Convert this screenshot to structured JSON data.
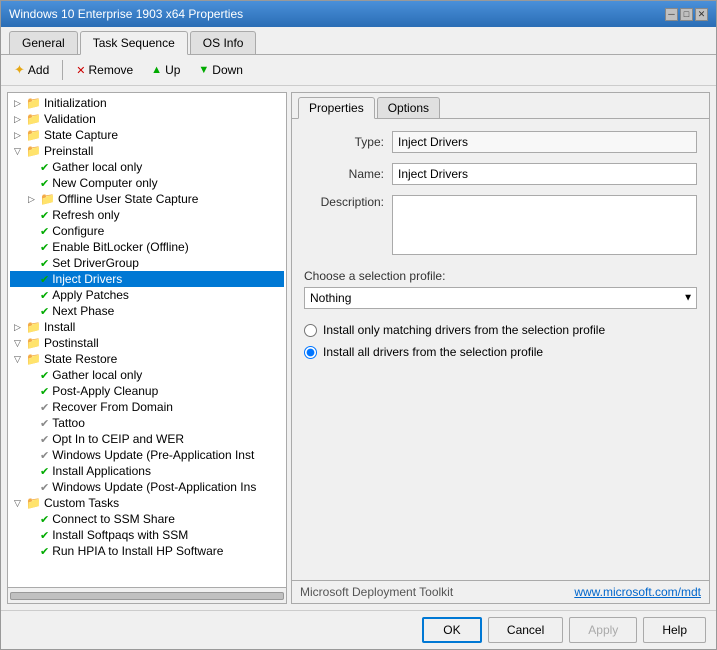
{
  "window": {
    "title": "Windows 10 Enterprise 1903 x64 Properties"
  },
  "tabs": [
    {
      "label": "General",
      "active": false
    },
    {
      "label": "Task Sequence",
      "active": true
    },
    {
      "label": "OS Info",
      "active": false
    }
  ],
  "toolbar": {
    "add_label": "Add",
    "remove_label": "Remove",
    "up_label": "Up",
    "down_label": "Down"
  },
  "tree": {
    "items": [
      {
        "indent": 1,
        "icon": "expand",
        "type": "folder",
        "label": "Initialization",
        "expanded": true
      },
      {
        "indent": 1,
        "icon": "expand",
        "type": "folder",
        "label": "Validation",
        "expanded": true
      },
      {
        "indent": 1,
        "icon": "expand",
        "type": "folder",
        "label": "State Capture",
        "expanded": true
      },
      {
        "indent": 1,
        "icon": "expand-open",
        "type": "folder",
        "label": "Preinstall",
        "expanded": true
      },
      {
        "indent": 2,
        "icon": "check",
        "type": "task",
        "label": "Gather local only"
      },
      {
        "indent": 2,
        "icon": "check",
        "type": "task",
        "label": "New Computer only"
      },
      {
        "indent": 2,
        "icon": "expand",
        "type": "folder",
        "label": "Offline User State Capture",
        "expanded": false
      },
      {
        "indent": 2,
        "icon": "check",
        "type": "task",
        "label": "Refresh only"
      },
      {
        "indent": 2,
        "icon": "check",
        "type": "task",
        "label": "Configure"
      },
      {
        "indent": 2,
        "icon": "check",
        "type": "task",
        "label": "Enable BitLocker (Offline)"
      },
      {
        "indent": 2,
        "icon": "check",
        "type": "task",
        "label": "Set DriverGroup"
      },
      {
        "indent": 2,
        "icon": "check",
        "type": "task",
        "label": "Inject Drivers",
        "selected": true
      },
      {
        "indent": 2,
        "icon": "check",
        "type": "task",
        "label": "Apply Patches"
      },
      {
        "indent": 2,
        "icon": "check",
        "type": "task",
        "label": "Next Phase"
      },
      {
        "indent": 1,
        "icon": "expand",
        "type": "folder",
        "label": "Install",
        "expanded": true
      },
      {
        "indent": 1,
        "icon": "expand-open",
        "type": "folder",
        "label": "Postinstall",
        "expanded": true
      },
      {
        "indent": 1,
        "icon": "expand-open",
        "type": "folder",
        "label": "State Restore",
        "expanded": true
      },
      {
        "indent": 2,
        "icon": "check",
        "type": "task",
        "label": "Gather local only"
      },
      {
        "indent": 2,
        "icon": "check",
        "type": "task",
        "label": "Post-Apply Cleanup"
      },
      {
        "indent": 2,
        "icon": "check-gray",
        "type": "task",
        "label": "Recover From Domain"
      },
      {
        "indent": 2,
        "icon": "check-gray",
        "type": "task",
        "label": "Tattoo"
      },
      {
        "indent": 2,
        "icon": "check-gray",
        "type": "task",
        "label": "Opt In to CEIP and WER"
      },
      {
        "indent": 2,
        "icon": "check-gray",
        "type": "task",
        "label": "Windows Update (Pre-Application Inst"
      },
      {
        "indent": 2,
        "icon": "check",
        "type": "task",
        "label": "Install Applications"
      },
      {
        "indent": 2,
        "icon": "check-gray",
        "type": "task",
        "label": "Windows Update (Post-Application Ins"
      },
      {
        "indent": 1,
        "icon": "expand-open",
        "type": "folder",
        "label": "Custom Tasks",
        "expanded": true
      },
      {
        "indent": 2,
        "icon": "check",
        "type": "task",
        "label": "Connect to SSM Share"
      },
      {
        "indent": 2,
        "icon": "check",
        "type": "task",
        "label": "Install Softpaqs with SSM"
      },
      {
        "indent": 2,
        "icon": "check",
        "type": "task",
        "label": "Run HPIA to Install HP Software"
      }
    ]
  },
  "right_panel": {
    "tabs": [
      {
        "label": "Properties",
        "active": true
      },
      {
        "label": "Options",
        "active": false
      }
    ],
    "fields": {
      "type_label": "Type:",
      "type_value": "Inject Drivers",
      "name_label": "Name:",
      "name_value": "Inject Drivers",
      "description_label": "Description:",
      "description_value": "",
      "selection_profile_label": "Choose a selection profile:",
      "selection_profile_value": "Nothing",
      "radio_option1": "Install only matching drivers from the selection profile",
      "radio_option2": "Install all drivers from the selection profile"
    }
  },
  "footer": {
    "brand": "Microsoft Deployment Toolkit",
    "link": "www.microsoft.com/mdt"
  },
  "buttons": {
    "ok": "OK",
    "cancel": "Cancel",
    "apply": "Apply",
    "help": "Help"
  },
  "icons": {
    "add": "✦",
    "remove": "✕",
    "up": "▲",
    "down": "▼",
    "expand_closed": "▷",
    "expand_open": "▽",
    "folder": "📁",
    "check": "✔",
    "check_gray": "✔",
    "close": "✕",
    "minimize": "─",
    "maximize": "□"
  }
}
